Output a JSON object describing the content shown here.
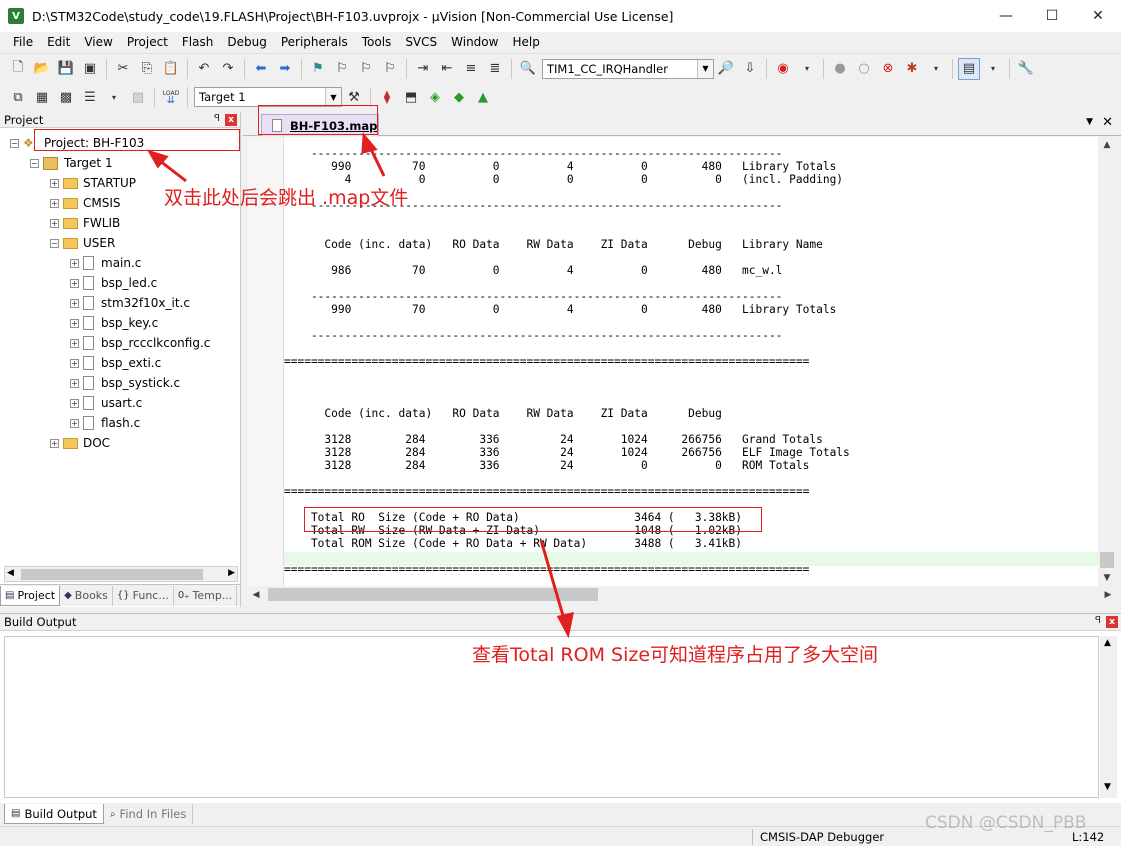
{
  "window": {
    "title": "D:\\STM32Code\\study_code\\19.FLASH\\Project\\BH-F103.uvprojx - µVision  [Non-Commercial Use License]",
    "app_icon": "V",
    "minimize": "—",
    "maximize": "☐",
    "close": "✕"
  },
  "menu": [
    "File",
    "Edit",
    "View",
    "Project",
    "Flash",
    "Debug",
    "Peripherals",
    "Tools",
    "SVCS",
    "Window",
    "Help"
  ],
  "toolbar1": {
    "function_combo": "TIM1_CC_IRQHandler"
  },
  "toolbar2": {
    "target_combo": "Target 1",
    "load_label": "LOAD"
  },
  "project_panel": {
    "title": "Project",
    "pin": "ꟼ",
    "close": "x",
    "project_root": "Project: BH-F103",
    "target": "Target 1",
    "groups": [
      "STARTUP",
      "CMSIS",
      "FWLIB",
      "USER"
    ],
    "user_files": [
      "main.c",
      "bsp_led.c",
      "stm32f10x_it.c",
      "bsp_key.c",
      "bsp_rccclkconfig.c",
      "bsp_exti.c",
      "bsp_systick.c",
      "usart.c",
      "flash.c"
    ],
    "doc_group": "DOC",
    "tabs": [
      "Project",
      "Books",
      "Func...",
      "Temp..."
    ],
    "tab_icons": [
      "▤",
      "◆",
      "{}",
      "0₊"
    ]
  },
  "editor": {
    "tab_label": "BH-F103.map",
    "content_lines": [
      "    ----------------------------------------------------------------------",
      "       990         70          0          4          0        480   Library Totals",
      "         4          0          0          0          0          0   (incl. Padding)",
      "",
      "    ----------------------------------------------------------------------",
      "",
      "",
      "      Code (inc. data)   RO Data    RW Data    ZI Data      Debug   Library Name",
      "",
      "       986         70          0          4          0        480   mc_w.l",
      "",
      "    ----------------------------------------------------------------------",
      "       990         70          0          4          0        480   Library Totals",
      "",
      "    ----------------------------------------------------------------------",
      "",
      "==============================================================================",
      "",
      "",
      "",
      "      Code (inc. data)   RO Data    RW Data    ZI Data      Debug",
      "",
      "      3128        284        336         24       1024     266756   Grand Totals",
      "      3128        284        336         24       1024     266756   ELF Image Totals",
      "      3128        284        336         24          0          0   ROM Totals",
      "",
      "==============================================================================",
      "",
      "    Total RO  Size (Code + RO Data)                 3464 (   3.38kB)",
      "    Total RW  Size (RW Data + ZI Data)              1048 (   1.02kB)",
      "    Total ROM Size (Code + RO Data + RW Data)       3488 (   3.41kB)",
      "",
      "=============================================================================="
    ]
  },
  "build_output": {
    "title": "Build Output",
    "tabs": [
      "Build Output",
      "Find In Files"
    ]
  },
  "status_bar": {
    "debugger": "CMSIS-DAP Debugger",
    "line": "L:142",
    "watermark": "CSDN @CSDN_PBB"
  },
  "annotations": {
    "double_click_note": "双击此处后会跳出 .map文件",
    "rom_size_note": "查看Total ROM Size可知道程序占用了多大空间",
    "color": "#e02020"
  }
}
